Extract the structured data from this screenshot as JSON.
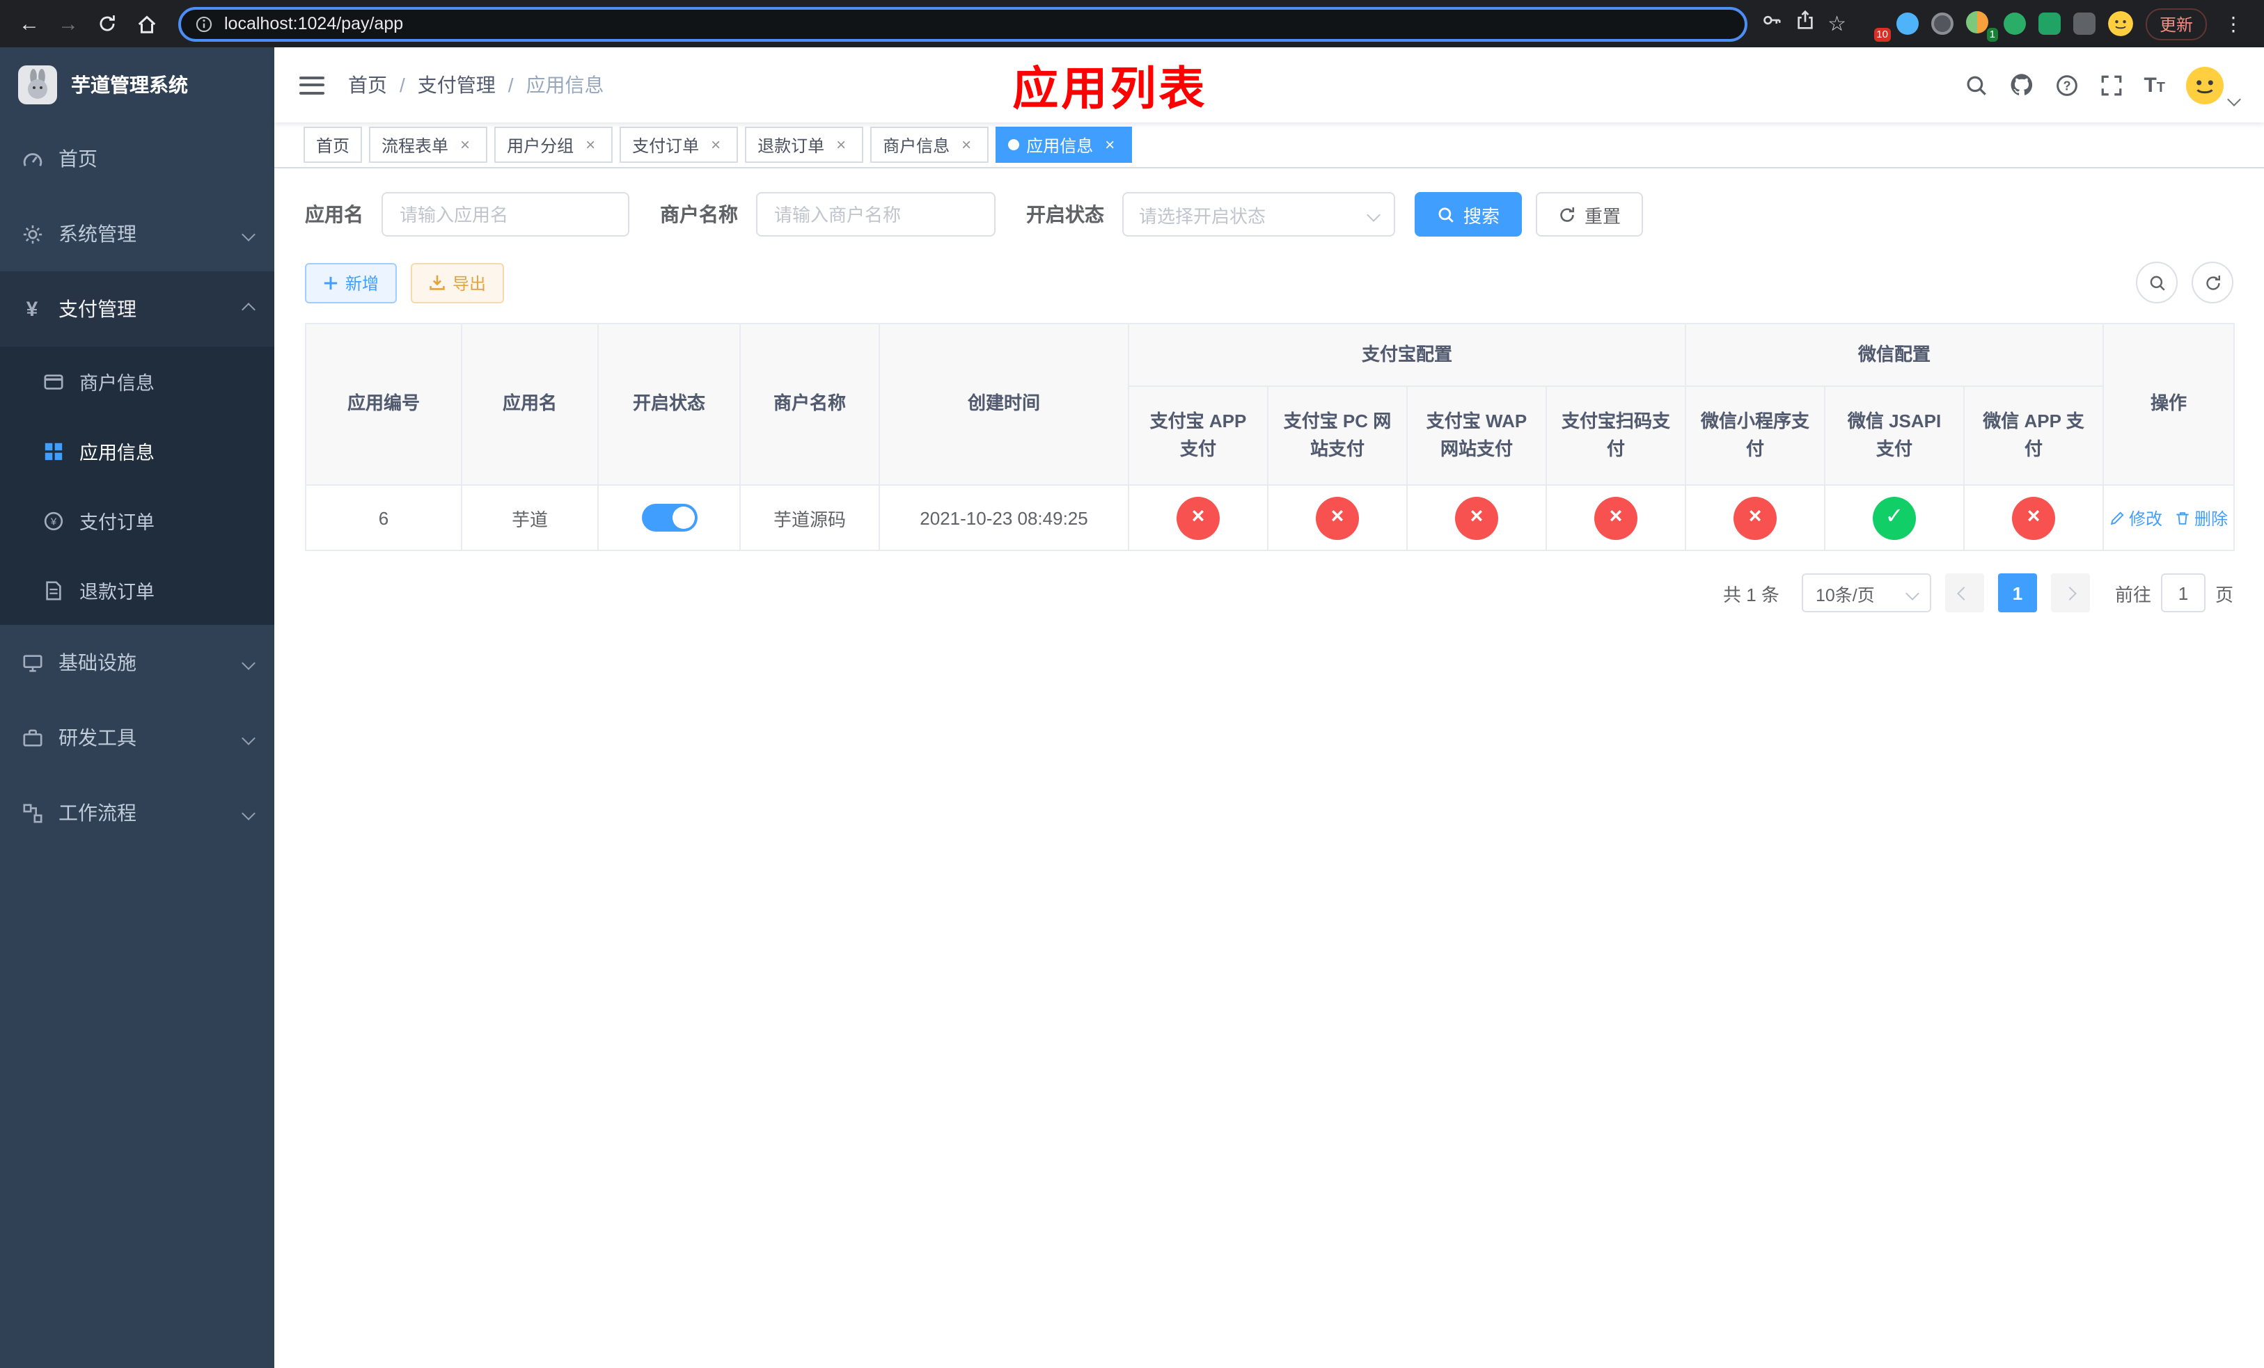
{
  "browser": {
    "url": "localhost:1024/pay/app",
    "update_button": "更新",
    "badges": {
      "extensions": "10",
      "profile": "1"
    }
  },
  "sidebar": {
    "app_title": "芋道管理系统",
    "menu": [
      {
        "label": "首页"
      },
      {
        "label": "系统管理"
      },
      {
        "label": "支付管理"
      },
      {
        "label": "基础设施"
      },
      {
        "label": "研发工具"
      },
      {
        "label": "工作流程"
      }
    ],
    "submenu": [
      {
        "label": "商户信息"
      },
      {
        "label": "应用信息"
      },
      {
        "label": "支付订单"
      },
      {
        "label": "退款订单"
      }
    ]
  },
  "header": {
    "breadcrumb": [
      "首页",
      "支付管理",
      "应用信息"
    ],
    "annotation": "应用列表"
  },
  "tabs": [
    {
      "label": "首页"
    },
    {
      "label": "流程表单"
    },
    {
      "label": "用户分组"
    },
    {
      "label": "支付订单"
    },
    {
      "label": "退款订单"
    },
    {
      "label": "商户信息"
    },
    {
      "label": "应用信息"
    }
  ],
  "filters": {
    "app_name_label": "应用名",
    "app_name_placeholder": "请输入应用名",
    "merchant_label": "商户名称",
    "merchant_placeholder": "请输入商户名称",
    "status_label": "开启状态",
    "status_placeholder": "请选择开启状态",
    "search_button": "搜索",
    "reset_button": "重置"
  },
  "toolbar": {
    "add_button": "新增",
    "export_button": "导出"
  },
  "table": {
    "columns": {
      "app_id": "应用编号",
      "app_name": "应用名",
      "status": "开启状态",
      "merchant": "商户名称",
      "created": "创建时间",
      "alipay_group": "支付宝配置",
      "wechat_group": "微信配置",
      "alipay_app": "支付宝 APP 支付",
      "alipay_pc": "支付宝 PC 网站支付",
      "alipay_wap": "支付宝 WAP 网站支付",
      "alipay_qr": "支付宝扫码支付",
      "wechat_mini": "微信小程序支付",
      "wechat_jsapi": "微信 JSAPI 支付",
      "wechat_app": "微信 APP 支付",
      "actions": "操作"
    },
    "rows": [
      {
        "app_id": "6",
        "app_name": "芋道",
        "status_on": true,
        "merchant": "芋道源码",
        "created": "2021-10-23 08:49:25",
        "alipay_app": false,
        "alipay_pc": false,
        "alipay_wap": false,
        "alipay_qr": false,
        "wechat_mini": false,
        "wechat_jsapi": true,
        "wechat_app": false,
        "edit_label": "修改",
        "delete_label": "删除"
      }
    ]
  },
  "pagination": {
    "total_text": "共 1 条",
    "page_size": "10条/页",
    "current_page": "1",
    "goto_label": "前往",
    "goto_value": "1",
    "unit_label": "页"
  }
}
